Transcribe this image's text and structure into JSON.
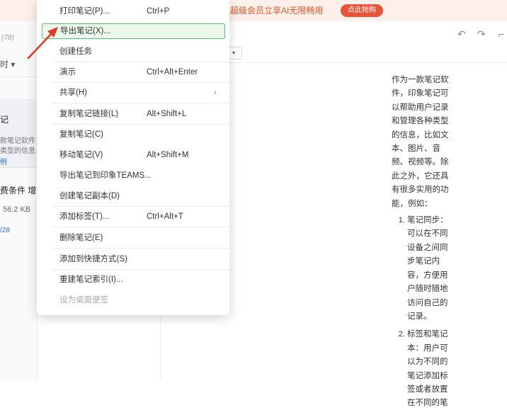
{
  "banner": {
    "text": "，超级会员立享AI无限畅用",
    "button": "点此抢购"
  },
  "left_panel": {
    "count": "(78)",
    "sort": "时 ▾",
    "card1": {
      "title": "记",
      "line1": "款笔记软件，",
      "line2": "类型的信息，",
      "line3": "例"
    },
    "card2": {
      "title": "费条件 增",
      "size": "56.2 KB",
      "date": "/28"
    }
  },
  "toolbar": {
    "undo_icon": "↶",
    "redo_icon": "↷",
    "corner_icon": "⌐",
    "font_dropdown": "▾"
  },
  "menu": {
    "items": [
      {
        "label": "打印笔记(P)...",
        "shortcut": "Ctrl+P"
      },
      {
        "label": "导出笔记(X)...",
        "shortcut": ""
      },
      {
        "label": "创建任务",
        "shortcut": ""
      },
      {
        "label": "演示",
        "shortcut": "Ctrl+Alt+Enter"
      },
      {
        "label": "共享(H)",
        "shortcut": "",
        "submenu": "›"
      },
      {
        "label": "复制笔记链接(L)",
        "shortcut": "Alt+Shift+L"
      },
      {
        "label": "复制笔记(C)",
        "shortcut": ""
      },
      {
        "label": "移动笔记(V)",
        "shortcut": "Alt+Shift+M"
      },
      {
        "label": "导出笔记到印象TEAMS...",
        "shortcut": ""
      },
      {
        "label": "创建笔记副本(D)",
        "shortcut": ""
      },
      {
        "label": "添加标签(T)...",
        "shortcut": "Ctrl+Alt+T"
      },
      {
        "label": "删除笔记(E)",
        "shortcut": ""
      },
      {
        "label": "添加到快捷方式(S)",
        "shortcut": ""
      },
      {
        "label": "重建笔记索引(I)...",
        "shortcut": ""
      },
      {
        "label": "设为桌面便签",
        "shortcut": ""
      }
    ]
  },
  "document": {
    "intro": "作为一款笔记软件，印象笔记可以帮助用户记录和管理各种类型的信息，比如文本、图片、音频、视频等。除此之外，它还具有很多实用的功能，例如：",
    "list": [
      "笔记同步：可以在不同设备之间同步笔记内容，方便用户随时随地访问自己的记录。",
      "标签和笔记本：用户可以为不同的笔记添加标签或者放置在不同的笔"
    ]
  },
  "colors": {
    "banner_bg": "#fdf0ea",
    "banner_accent": "#e8543a",
    "highlight_border": "#58c46a",
    "highlight_bg": "#ecf8ea",
    "annotation_arrow": "#e03a2a"
  }
}
